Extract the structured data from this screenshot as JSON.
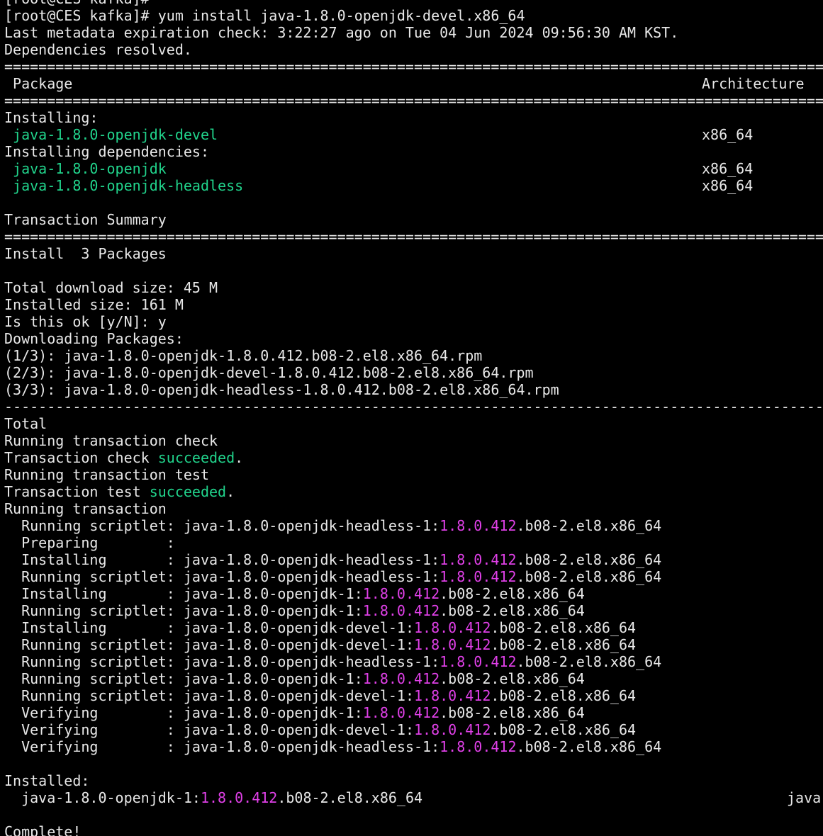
{
  "colors": {
    "background": "#000000",
    "foreground": "#e8e8e8",
    "green": "#21d48c",
    "magenta": "#e040e8"
  },
  "terminal": {
    "top_partial": "[root@CES kafka]#",
    "prompt": "[root@CES kafka]# ",
    "command": "yum install java-1.8.0-openjdk-devel.x86_64",
    "metadata": "Last metadata expiration check: 3:22:27 ago on Tue 04 Jun 2024 09:56:30 AM KST.",
    "deps_resolved": "Dependencies resolved.",
    "sep_equals": "=================================================================================================",
    "sep_dashes": "-------------------------------------------------------------------------------------------------",
    "header_package": " Package",
    "header_arch": "Architecture",
    "installing": "Installing:",
    "pkg_devel": " java-1.8.0-openjdk-devel",
    "arch": "x86_64",
    "installing_deps": "Installing dependencies:",
    "pkg_openjdk": " java-1.8.0-openjdk",
    "pkg_headless": " java-1.8.0-openjdk-headless",
    "transaction_summary": "Transaction Summary",
    "install_count": "Install  3 Packages",
    "total_download": "Total download size: 45 M",
    "installed_size": "Installed size: 161 M",
    "confirm": "Is this ok [y/N]: y",
    "downloading": "Downloading Packages:",
    "dl1": "(1/3): java-1.8.0-openjdk-1.8.0.412.b08-2.el8.x86_64.rpm",
    "dl2": "(2/3): java-1.8.0-openjdk-devel-1.8.0.412.b08-2.el8.x86_64.rpm",
    "dl3": "(3/3): java-1.8.0-openjdk-headless-1.8.0.412.b08-2.el8.x86_64.rpm",
    "total": "Total",
    "running_check": "Running transaction check",
    "check_prefix": "Transaction check ",
    "test_prefix": "Transaction test ",
    "succeeded": "succeeded",
    "period": ".",
    "running_test": "Running transaction test",
    "running_transaction": "Running transaction",
    "step_scriptlet": "  Running scriptlet: ",
    "step_preparing": "  Preparing        :",
    "step_installing": "  Installing       : ",
    "step_verifying": "  Verifying        : ",
    "name_headless": "java-1.8.0-openjdk-headless-1:",
    "name_openjdk": "java-1.8.0-openjdk-1:",
    "name_devel": "java-1.8.0-openjdk-devel-1:",
    "version": "1.8.0.412",
    "release_suffix": ".b08-2.el8.x86_64",
    "installed_label": "Installed:",
    "installed_indent": "  java-1.8.0-openjdk-1:",
    "installed_right": "java",
    "complete": "Complete!"
  }
}
